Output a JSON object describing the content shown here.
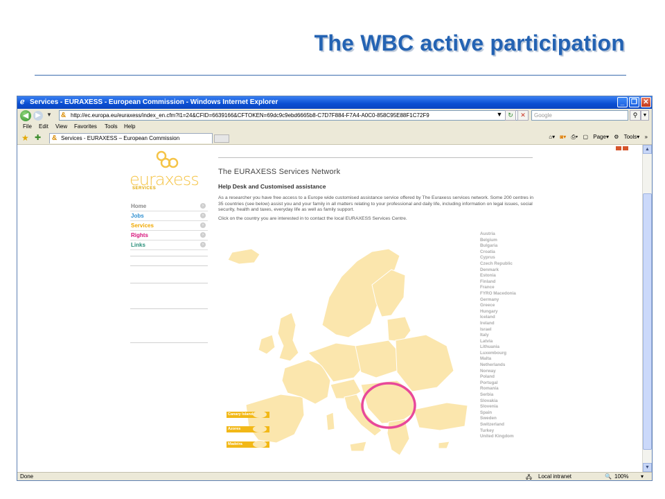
{
  "slide": {
    "title": "The WBC active participation"
  },
  "browser": {
    "window_title": "Services - EURAXESS - European Commission - Windows Internet Explorer",
    "url": "http://ec.europa.eu/euraxess/index_en.cfm?l1=24&CFID=6639166&CFTOKEN=69dc9c9ebd6665b8-C7D7F884-F7A4-A0C0-858C95E88F1C72F9",
    "search_placeholder": "Google",
    "menu": [
      "File",
      "Edit",
      "View",
      "Favorites",
      "Tools",
      "Help"
    ],
    "tab_label": "Services - EURAXESS – European Commission",
    "commands": {
      "page": "Page",
      "tools": "Tools"
    },
    "status": {
      "left": "Done",
      "zone": "Local intranet",
      "zoom": "100%"
    }
  },
  "page": {
    "logo": {
      "word": "euraxess",
      "sub": "SERVICES"
    },
    "nav": [
      {
        "label": "Home",
        "color": "#888888"
      },
      {
        "label": "Jobs",
        "color": "#2f8fd0"
      },
      {
        "label": "Services",
        "color": "#f0a800"
      },
      {
        "label": "Rights",
        "color": "#d6127a"
      },
      {
        "label": "Links",
        "color": "#2a8f7a"
      }
    ],
    "heading": "The EURAXESS Services Network",
    "subheading": "Help Desk and Customised assistance",
    "intro": "As a researcher you have free access to a Europe wide customised assistance service offered by The Euraxess services network. Some 200 centres in 35 countries (see below) assist you and your family in all matters relating to your professional and daily life, including information on legal issues, social security, health and taxes, everyday life as well as family support.",
    "click_text": "Click on the country you are interested in to contact the local EURAXESS Services Centre.",
    "countries": [
      "Austria",
      "Belgium",
      "Bulgaria",
      "Croatia",
      "Cyprus",
      "Czech Republic",
      "Denmark",
      "Estonia",
      "Finland",
      "France",
      "FYRO Macedonia",
      "Germany",
      "Greece",
      "Hungary",
      "Iceland",
      "Ireland",
      "Israel",
      "Italy",
      "Latvia",
      "Lithuania",
      "Luxembourg",
      "Malta",
      "Netherlands",
      "Norway",
      "Poland",
      "Portugal",
      "Romania",
      "Serbia",
      "Slovakia",
      "Slovenia",
      "Spain",
      "Sweden",
      "Switzerland",
      "Turkey",
      "United Kingdom"
    ],
    "insets": [
      "Canary Island",
      "Azores",
      "Madeira"
    ],
    "highlight_color": "#e8489a",
    "map_color": "#fbe6ad"
  }
}
